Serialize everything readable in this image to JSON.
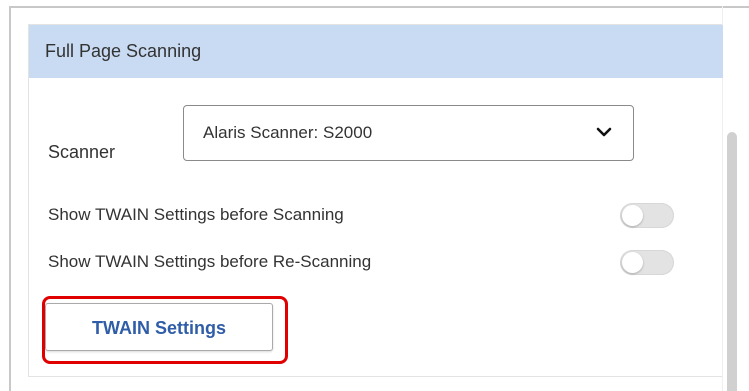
{
  "section": {
    "title": "Full Page Scanning"
  },
  "scanner": {
    "label": "Scanner",
    "selected": "Alaris Scanner: S2000",
    "dropdown_icon": "chevron-down-icon"
  },
  "settings": {
    "before_scan_label": "Show TWAIN Settings before Scanning",
    "before_rescan_label": "Show TWAIN Settings before Re-Scanning",
    "before_scan_enabled": false,
    "before_rescan_enabled": false
  },
  "actions": {
    "twain_settings_label": "TWAIN Settings"
  },
  "colors": {
    "header_background": "#c9dbf3",
    "button_text": "#2f5da8",
    "highlight": "#e00000"
  }
}
